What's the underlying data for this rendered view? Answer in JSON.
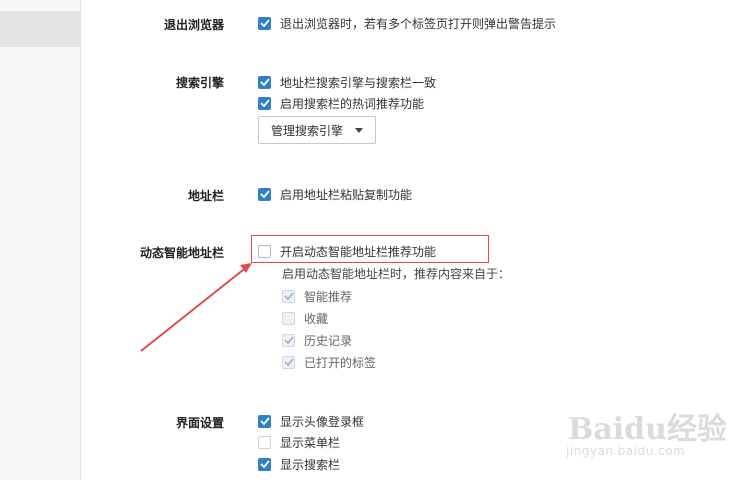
{
  "sections": {
    "exit": {
      "label": "退出浏览器",
      "options": [
        {
          "label": "退出浏览器时，若有多个标签页打开则弹出警告提示",
          "checked": true
        }
      ]
    },
    "search": {
      "label": "搜索引擎",
      "options": [
        {
          "label": "地址栏搜索引擎与搜索栏一致",
          "checked": true
        },
        {
          "label": "启用搜索栏的热词推荐功能",
          "checked": true
        }
      ],
      "manage_button": "管理搜索引擎"
    },
    "addressbar": {
      "label": "地址栏",
      "options": [
        {
          "label": "启用地址栏粘贴复制功能",
          "checked": true
        }
      ]
    },
    "smart": {
      "label": "动态智能地址栏",
      "main_option": {
        "label": "开启动态智能地址栏推荐功能",
        "checked": false
      },
      "hint": "启用动态智能地址栏时，推荐内容来自于：",
      "sources": [
        {
          "label": "智能推荐",
          "checked": true
        },
        {
          "label": "收藏",
          "checked": false
        },
        {
          "label": "历史记录",
          "checked": true
        },
        {
          "label": "已打开的标签",
          "checked": true
        }
      ]
    },
    "ui": {
      "label": "界面设置",
      "options": [
        {
          "label": "显示头像登录框",
          "checked": true
        },
        {
          "label": "显示菜单栏",
          "checked": false
        },
        {
          "label": "显示搜索栏",
          "checked": true
        }
      ]
    }
  },
  "watermark": {
    "main": "Baidu经验",
    "sub": "jingyan.baidu.com"
  },
  "colors": {
    "checkbox_checked": "#2f80c8",
    "highlight": "#e24a4a"
  }
}
